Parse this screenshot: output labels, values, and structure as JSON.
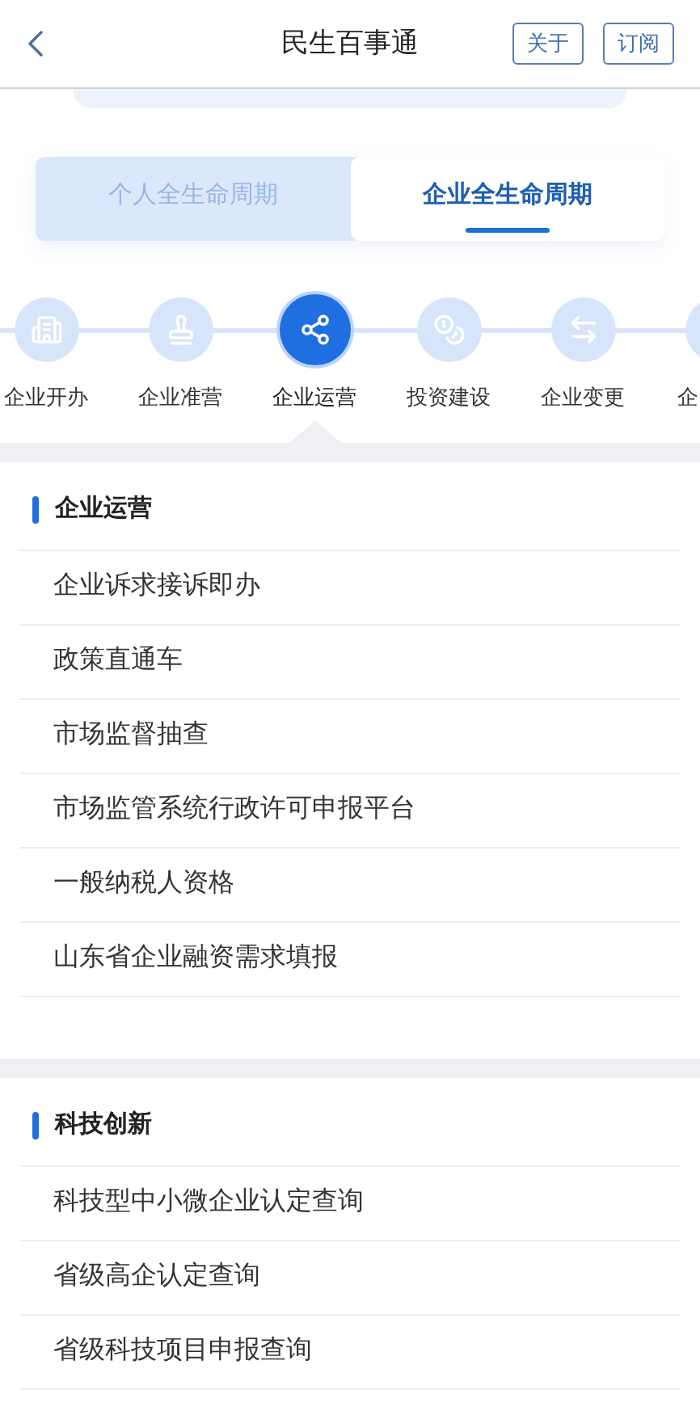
{
  "header": {
    "title": "民生百事通",
    "buttons": [
      "关于",
      "订阅"
    ]
  },
  "tabs": [
    {
      "label": "个人全生命周期",
      "selected": false
    },
    {
      "label": "企业全生命周期",
      "selected": true
    }
  ],
  "steps": [
    {
      "label": "企业开办",
      "selected": false
    },
    {
      "label": "企业准营",
      "selected": false
    },
    {
      "label": "企业运营",
      "selected": true
    },
    {
      "label": "投资建设",
      "selected": false
    },
    {
      "label": "企业变更",
      "selected": false
    },
    {
      "label": "企",
      "selected": false
    }
  ],
  "sections": [
    {
      "title": "企业运营",
      "items": [
        "企业诉求接诉即办",
        "政策直通车",
        "市场监督抽查",
        "市场监管系统行政许可申报平台",
        "一般纳税人资格",
        "山东省企业融资需求填报"
      ]
    },
    {
      "title": "科技创新",
      "items": [
        "科技型中小微企业认定查询",
        "省级高企认定查询",
        "省级科技项目申报查询"
      ]
    }
  ]
}
